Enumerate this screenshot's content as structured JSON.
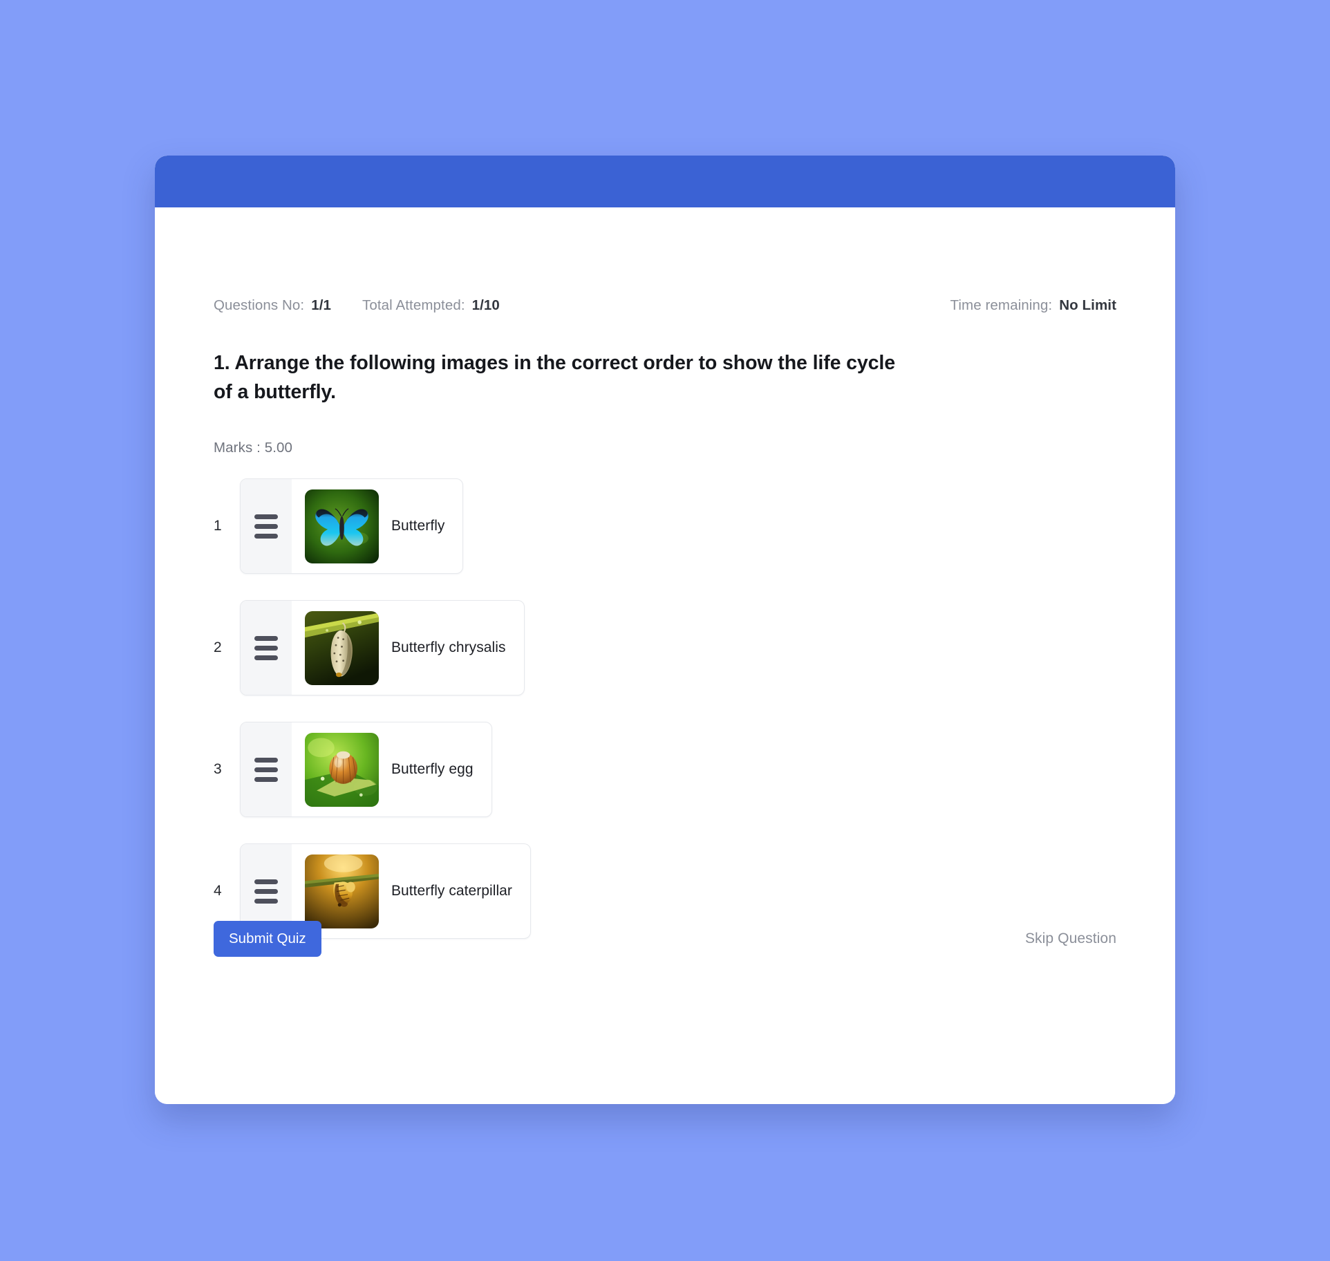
{
  "page": {
    "background_color": "#829DF9"
  },
  "card": {
    "header_bar_color": "#3B62D4",
    "background_color": "#FFFFFF"
  },
  "meta": {
    "questions_no_label": "Questions No:",
    "questions_no_value": "1/1",
    "total_attempted_label": "Total Attempted:",
    "total_attempted_value": "1/10",
    "time_remaining_label": "Time remaining:",
    "time_remaining_value": "No Limit"
  },
  "question": {
    "title": "1. Arrange the following images in the correct order to show the life cycle of a butterfly.",
    "marks": "Marks : 5.00"
  },
  "sortable_items": [
    {
      "index": "1",
      "label": "Butterfly",
      "handle_icon": "drag-handle-icon",
      "thumbnail_icon": "butterfly-photo"
    },
    {
      "index": "2",
      "label": "Butterfly chrysalis",
      "handle_icon": "drag-handle-icon",
      "thumbnail_icon": "chrysalis-photo"
    },
    {
      "index": "3",
      "label": "Butterfly egg",
      "handle_icon": "drag-handle-icon",
      "thumbnail_icon": "egg-photo"
    },
    {
      "index": "4",
      "label": "Butterfly caterpillar",
      "handle_icon": "drag-handle-icon",
      "thumbnail_icon": "caterpillar-photo"
    }
  ],
  "footer": {
    "submit_label": "Submit Quiz",
    "submit_color": "#3F68DD",
    "skip_label": "Skip Question"
  }
}
